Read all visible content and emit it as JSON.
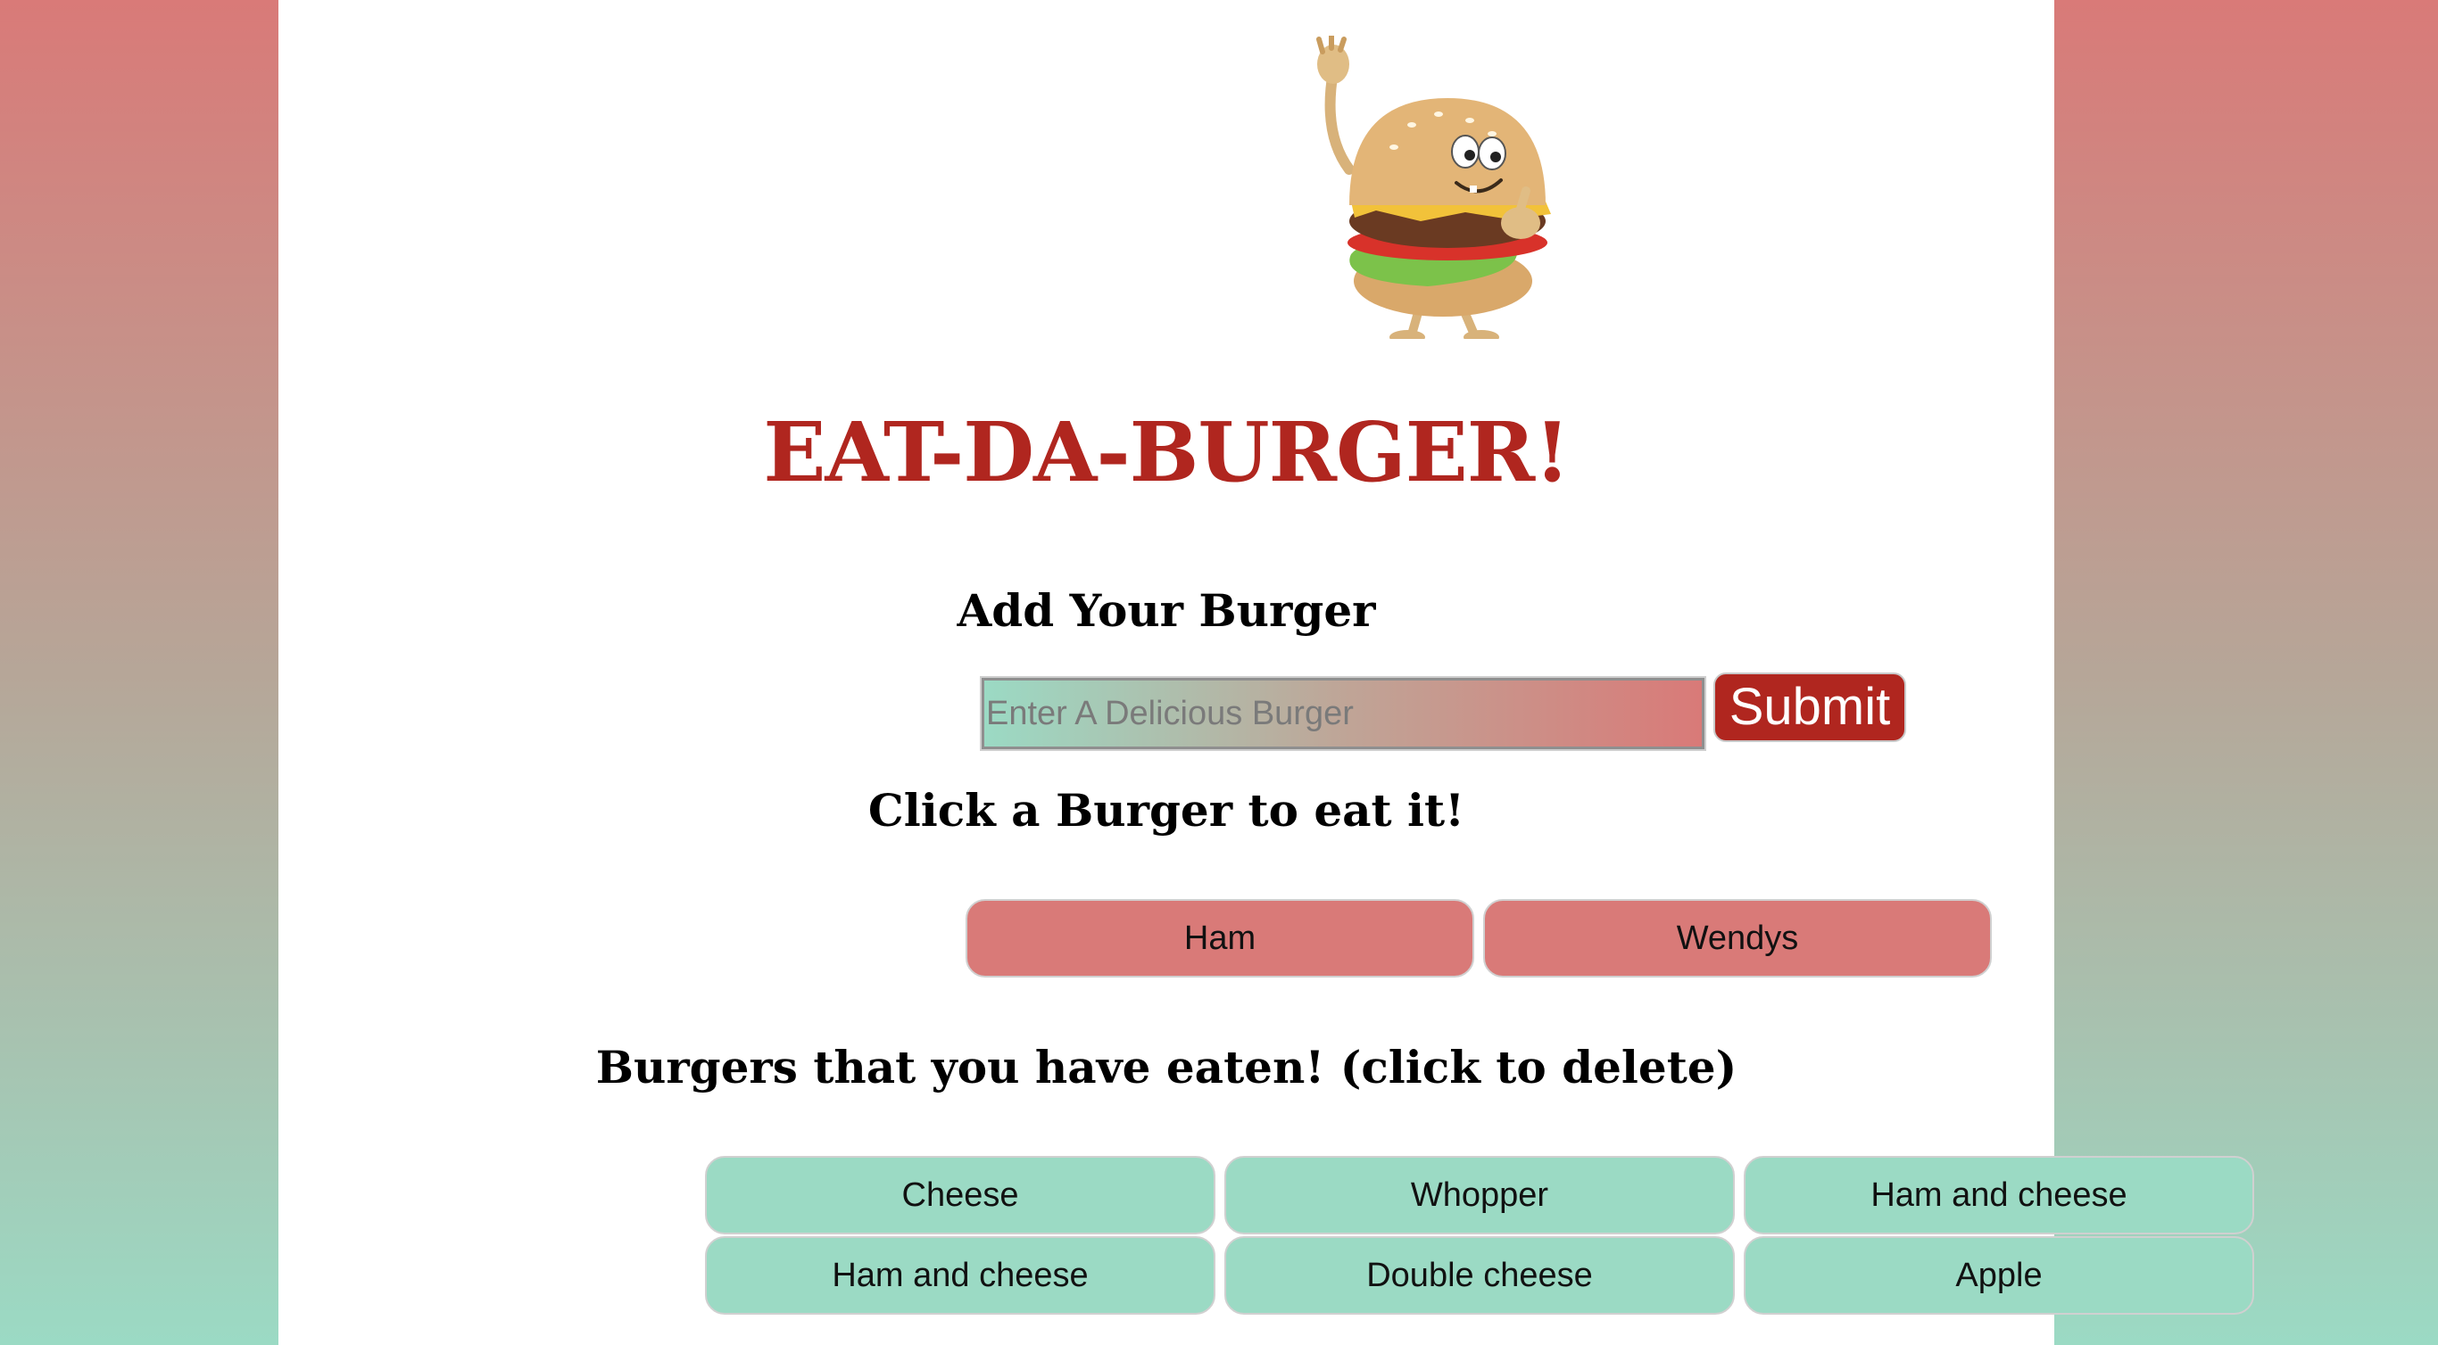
{
  "header": {
    "title": "EAT-DA-BURGER!"
  },
  "add_section": {
    "heading": "Add Your Burger",
    "input_placeholder": "Enter A Delicious Burger",
    "input_value": "",
    "submit_label": "Submit"
  },
  "uneaten_section": {
    "heading": "Click a Burger to eat it!",
    "burgers": [
      "Ham",
      "Wendys"
    ]
  },
  "eaten_section": {
    "heading": "Burgers that you have eaten! (click to delete)",
    "burgers": [
      "Cheese",
      "Whopper",
      "Ham and cheese",
      "Ham and cheese",
      "Double cheese",
      "Apple"
    ]
  },
  "colors": {
    "title_red": "#b0261f",
    "submit_red": "#b0261f",
    "uneaten_pink": "#d97a78",
    "eaten_mint": "#9bdac4"
  },
  "icons": {
    "mascot": "burger-mascot-icon"
  }
}
